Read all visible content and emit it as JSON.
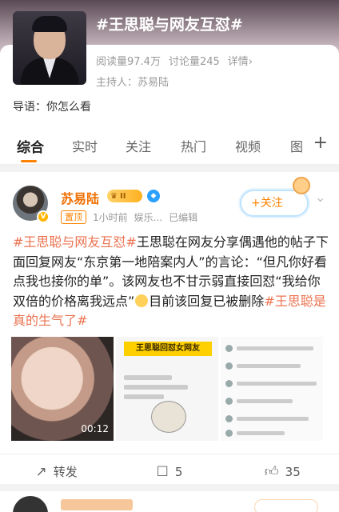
{
  "topic": {
    "title": "#王思聪与网友互怼#",
    "read_count": "阅读量97.4万",
    "discuss_count": "讨论量245",
    "details": "详情›",
    "host": "主持人：苏易陆",
    "intro": "导语：你怎么看"
  },
  "tabs": [
    {
      "label": "综合",
      "active": true
    },
    {
      "label": "实时",
      "active": false
    },
    {
      "label": "关注",
      "active": false
    },
    {
      "label": "热门",
      "active": false
    },
    {
      "label": "视频",
      "active": false
    },
    {
      "label": "图",
      "active": false
    }
  ],
  "tabs_more_icon": "plus-icon",
  "post": {
    "username": "苏易陆",
    "vip_level": "II",
    "pinned_label": "置顶",
    "time": "1小时前",
    "source": "娱乐...",
    "edited": "已编辑",
    "follow_label": "+关注",
    "hashtag_1": "#王思聪与网友互怼#",
    "text_1": "王思聪在网友分享偶遇他的帖子下面回复网友“东京第一地陪案内人”的言论：“但凡你好看点我也接你的单”。该网友也不甘示弱直接回怼“我给你双倍的价格离我远点”",
    "text_2": "目前该回复已被删除",
    "hashtag_2": "#王思聪是真的生气了#",
    "video_duration": "00:12",
    "image_2_banner": "王思聪回怼女网友",
    "actions": {
      "repost_label": "转发",
      "comment_count": "5",
      "like_count": "35"
    }
  },
  "colors": {
    "accent": "#ff8200",
    "hashtag": "#eb7350",
    "username": "#f06f00"
  }
}
